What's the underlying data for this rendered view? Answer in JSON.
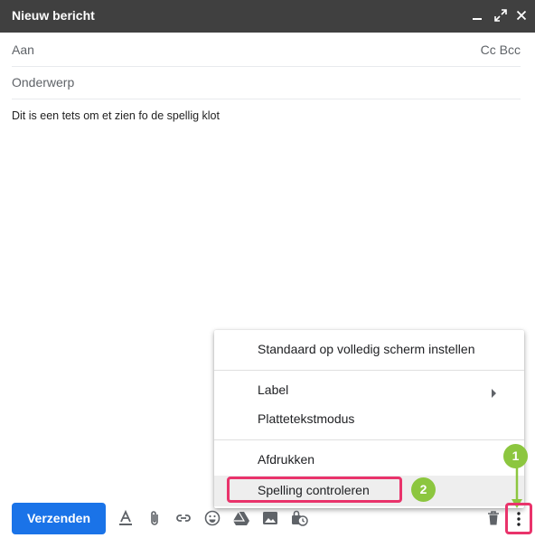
{
  "window": {
    "title": "Nieuw bericht",
    "controls": [
      "minimize-icon",
      "expand-icon",
      "close-icon"
    ]
  },
  "fields": {
    "to_label": "Aan",
    "cc_bcc": "Cc Bcc",
    "subject_label": "Onderwerp"
  },
  "body": {
    "text": "Dit is een tets om et zien fo de spellig klot"
  },
  "menu": {
    "items": [
      {
        "label": "Standaard op volledig scherm instellen"
      },
      {
        "label": "Label",
        "submenu_icon": "chevron-right-icon"
      },
      {
        "label": "Plattetekstmodus"
      },
      {
        "label": "Afdrukken"
      },
      {
        "label": "Spelling controleren",
        "highlighted": true
      }
    ]
  },
  "annotations": {
    "badge_1": "1",
    "badge_2": "2",
    "highlight_color": "#e9336b",
    "badge_color": "#8cc63f"
  },
  "toolbar": {
    "send_label": "Verzenden",
    "icons": [
      "format-text-icon",
      "attach-icon",
      "link-icon",
      "emoji-icon",
      "drive-icon",
      "photo-icon",
      "confidential-icon",
      "delete-icon",
      "more-options-icon"
    ]
  },
  "colors": {
    "titlebar": "#404040",
    "send_button": "#1a73e8"
  }
}
